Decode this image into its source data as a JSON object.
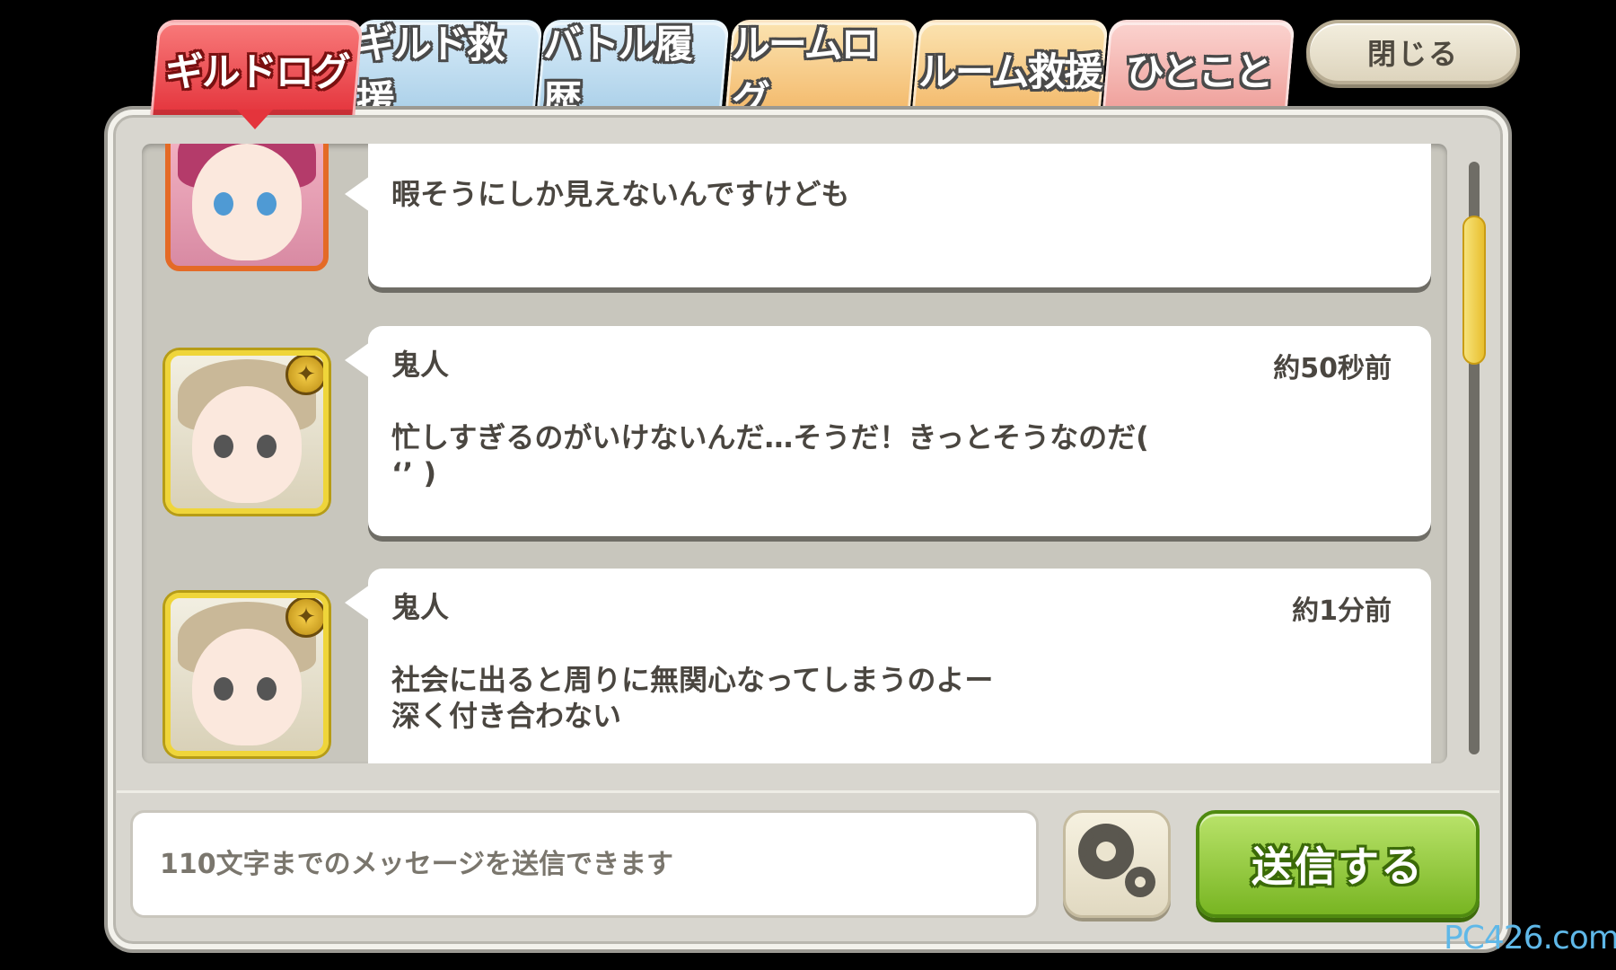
{
  "tabs": [
    {
      "label": "ギルドログ",
      "active": true,
      "color": "#e4343c"
    },
    {
      "label": "ギルド救援",
      "active": false,
      "color": "#a9cfe8"
    },
    {
      "label": "バトル履歴",
      "active": false,
      "color": "#a9cfe8"
    },
    {
      "label": "ルームログ",
      "active": false,
      "color": "#f3b869"
    },
    {
      "label": "ルーム救援",
      "active": false,
      "color": "#f3b869"
    },
    {
      "label": "ひとこと",
      "active": false,
      "color": "#ee9d98"
    }
  ],
  "close_label": "閉じる",
  "messages": [
    {
      "name": "",
      "time": "",
      "text": "暇そうにしか見えないんですけども",
      "avatar": "pink-hair-girl-avatar"
    },
    {
      "name": "鬼人",
      "time": "約50秒前",
      "text": "忙しすぎるのがいけないんだ…そうだ！きっとそうなのだ(\n  ‘’  )",
      "avatar": "blonde-girl-avatar"
    },
    {
      "name": "鬼人",
      "time": "約1分前",
      "text": "社会に出ると周りに無関心なってしまうのよー\n深く付き合わない",
      "avatar": "blonde-girl-avatar"
    }
  ],
  "input": {
    "placeholder": "110文字までのメッセージを送信できます",
    "value": ""
  },
  "send_label": "送信する",
  "watermark": "PC426.com",
  "colors": {
    "send": "#78b522",
    "scroll_thumb": "#e8bf2f",
    "panel": "#d8d6cf"
  }
}
